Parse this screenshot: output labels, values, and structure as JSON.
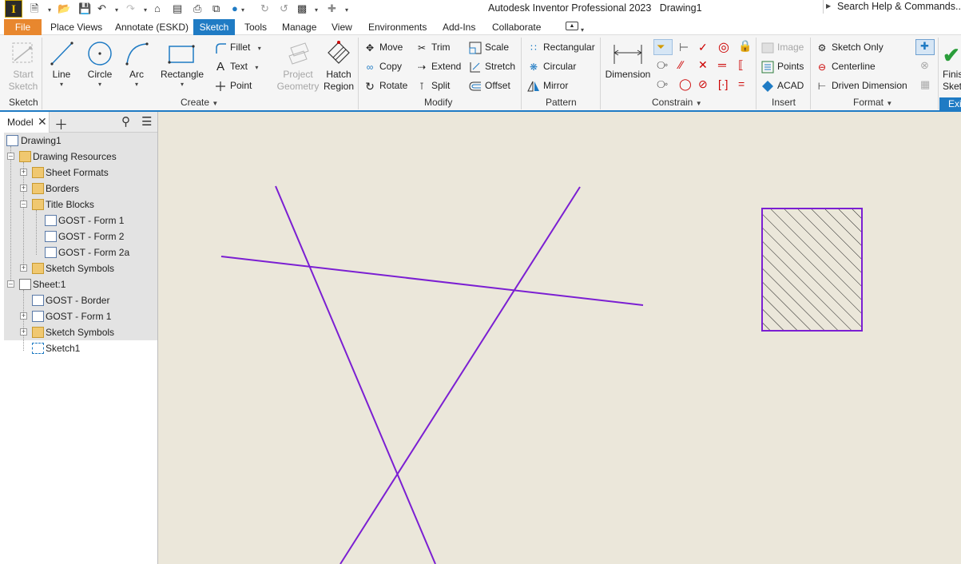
{
  "app": {
    "logo_letter": "I",
    "title": "Autodesk Inventor Professional 2023",
    "document": "Drawing1",
    "search_placeholder": "Search Help & Commands..."
  },
  "menu_tabs": [
    "File",
    "Place Views",
    "Annotate (ESKD)",
    "Sketch",
    "Tools",
    "Manage",
    "View",
    "Environments",
    "Add-Ins",
    "Collaborate"
  ],
  "active_tab": "Sketch",
  "ribbon": {
    "sketch_panel": {
      "label": "Sketch",
      "start_sketch": "Start Sketch"
    },
    "create_panel": {
      "label": "Create",
      "line": "Line",
      "circle": "Circle",
      "arc": "Arc",
      "rectangle": "Rectangle",
      "fillet": "Fillet",
      "text": "Text",
      "point": "Point",
      "project_geometry": "Project Geometry",
      "hatch_region": "Hatch Region"
    },
    "modify_panel": {
      "label": "Modify",
      "move": "Move",
      "copy": "Copy",
      "rotate": "Rotate",
      "trim": "Trim",
      "extend": "Extend",
      "split": "Split",
      "scale": "Scale",
      "stretch": "Stretch",
      "offset": "Offset"
    },
    "pattern_panel": {
      "label": "Pattern",
      "rectangular": "Rectangular",
      "circular": "Circular",
      "mirror": "Mirror"
    },
    "constrain_panel": {
      "label": "Constrain",
      "dimension": "Dimension"
    },
    "insert_panel": {
      "label": "Insert",
      "image": "Image",
      "points": "Points",
      "acad": "ACAD"
    },
    "format_panel": {
      "label": "Format",
      "sketch_only": "Sketch Only",
      "centerline": "Centerline",
      "driven_dimension": "Driven Dimension"
    },
    "exit_panel": {
      "finish": "Finish Sketch",
      "label": "Exit"
    }
  },
  "browser": {
    "tab_label": "Model",
    "tree": [
      {
        "label": "Drawing1",
        "level": 0
      },
      {
        "label": "Drawing Resources",
        "level": 1
      },
      {
        "label": "Sheet Formats",
        "level": 2
      },
      {
        "label": "Borders",
        "level": 2
      },
      {
        "label": "Title Blocks",
        "level": 2
      },
      {
        "label": "GOST - Form 1",
        "level": 3
      },
      {
        "label": "GOST - Form 2",
        "level": 3
      },
      {
        "label": "GOST - Form 2a",
        "level": 3
      },
      {
        "label": "Sketch Symbols",
        "level": 2
      },
      {
        "label": "Sheet:1",
        "level": 1
      },
      {
        "label": "GOST - Border",
        "level": 2
      },
      {
        "label": "GOST - Form 1",
        "level": 2
      },
      {
        "label": "Sketch Symbols",
        "level": 2
      },
      {
        "label": "Sketch1",
        "level": 2
      }
    ]
  },
  "colors": {
    "sketch_geometry": "#7b1fd2",
    "canvas_background": "#ebe7da",
    "file_tab": "#e8872e",
    "active_tab": "#1f7bc4"
  }
}
